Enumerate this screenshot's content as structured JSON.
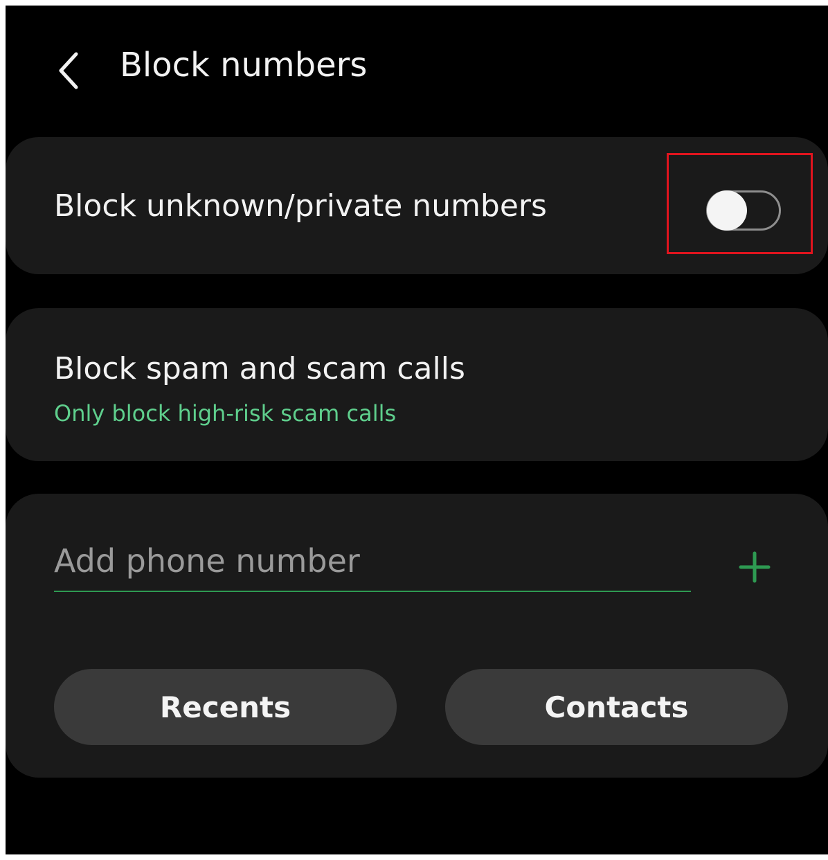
{
  "header": {
    "title": "Block numbers",
    "back_icon": "chevron-left-icon"
  },
  "block_unknown": {
    "label": "Block unknown/private numbers",
    "toggle_on": false
  },
  "block_spam": {
    "label": "Block spam and scam calls",
    "subtitle": "Only block high-risk scam calls"
  },
  "add_number": {
    "placeholder": "Add phone number",
    "value": "",
    "add_icon": "plus-icon"
  },
  "buttons": {
    "recents": "Recents",
    "contacts": "Contacts"
  },
  "colors": {
    "background": "#000000",
    "card": "#1a1a1a",
    "accent_green": "#5fcf8d",
    "input_underline": "#2e9a52",
    "plus_icon": "#2e9a52",
    "highlight_box": "#e0141e",
    "button_fill": "#3a3a3a"
  }
}
